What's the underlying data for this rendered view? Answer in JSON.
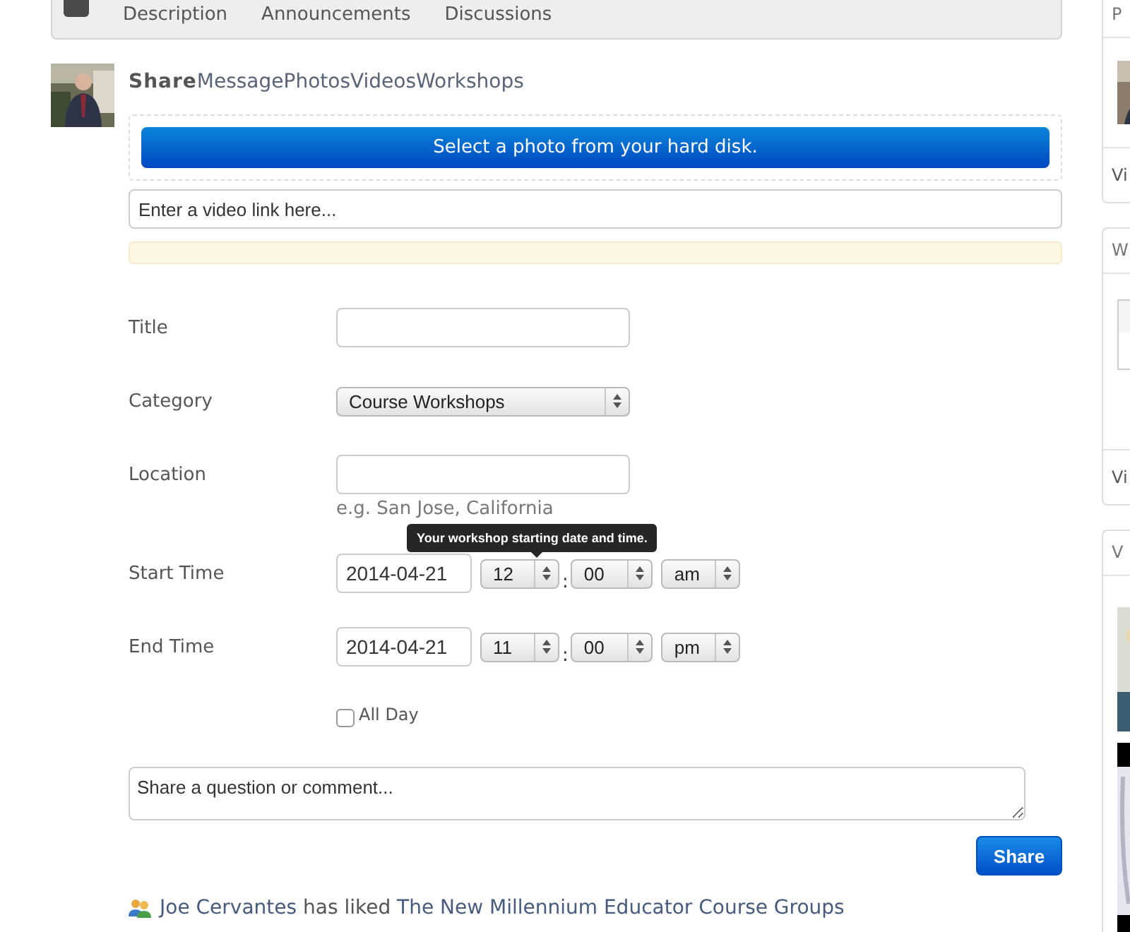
{
  "header_tabs": [
    {
      "label": "Description"
    },
    {
      "label": "Announcements"
    },
    {
      "label": "Discussions"
    }
  ],
  "composer": {
    "title": "Share",
    "tabs": [
      {
        "label": "Message"
      },
      {
        "label": "Photos"
      },
      {
        "label": "Videos"
      },
      {
        "label": "Workshops"
      }
    ],
    "photo_button": "Select a photo from your hard disk.",
    "video_link": {
      "placeholder": "Enter a video link here..."
    },
    "form": {
      "title": {
        "label": "Title"
      },
      "category": {
        "label": "Category",
        "value": "Course Workshops"
      },
      "location": {
        "label": "Location",
        "hint": "e.g. San Jose, California"
      },
      "tooltip": "Your workshop starting date and time.",
      "start_time": {
        "label": "Start Time",
        "date": "2014-04-21",
        "hour": "12",
        "separator": ":",
        "minute": "00",
        "meridiem": "am"
      },
      "end_time": {
        "label": "End Time",
        "date": "2014-04-21",
        "hour": "11",
        "separator": ":",
        "minute": "00",
        "meridiem": "pm"
      },
      "all_day": {
        "label": "All Day",
        "checked": false
      }
    },
    "comment": {
      "placeholder": "Share a question or comment..."
    },
    "share_button": "Share"
  },
  "activity": [
    {
      "actor": "Joe Cervantes",
      "action": "has liked",
      "target": "The New Millennium Educator Course Groups"
    }
  ],
  "sidebar": {
    "panels": [
      {
        "title": "P",
        "kind": "profile",
        "link": "Vi"
      },
      {
        "title": "W",
        "kind": "table",
        "link": "Vi"
      },
      {
        "title": "V",
        "kind": "videos"
      }
    ]
  }
}
